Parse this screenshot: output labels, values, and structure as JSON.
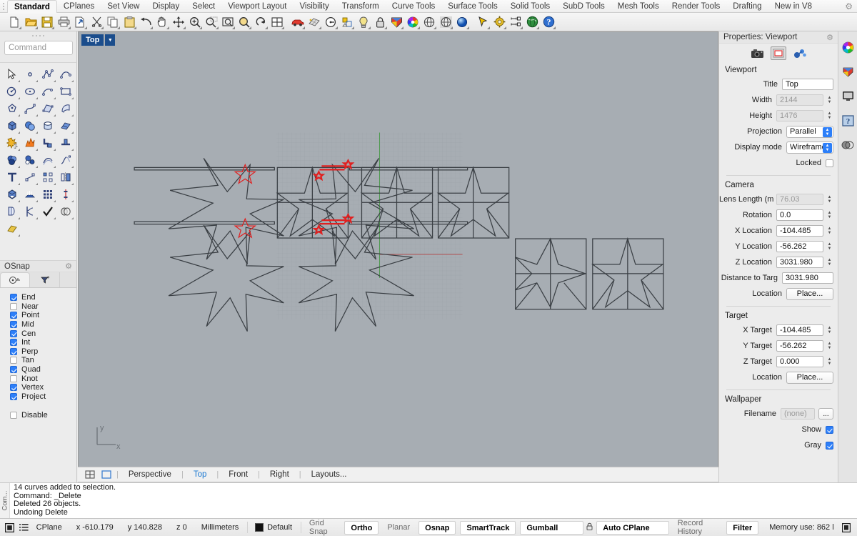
{
  "menu": {
    "items": [
      {
        "label": "Standard",
        "active": true
      },
      {
        "label": "CPlanes",
        "active": false
      },
      {
        "label": "Set View",
        "active": false
      },
      {
        "label": "Display",
        "active": false
      },
      {
        "label": "Select",
        "active": false
      },
      {
        "label": "Viewport Layout",
        "active": false
      },
      {
        "label": "Visibility",
        "active": false
      },
      {
        "label": "Transform",
        "active": false
      },
      {
        "label": "Curve Tools",
        "active": false
      },
      {
        "label": "Surface Tools",
        "active": false
      },
      {
        "label": "Solid Tools",
        "active": false
      },
      {
        "label": "SubD Tools",
        "active": false
      },
      {
        "label": "Mesh Tools",
        "active": false
      },
      {
        "label": "Render Tools",
        "active": false
      },
      {
        "label": "Drafting",
        "active": false
      },
      {
        "label": "New in V8",
        "active": false
      }
    ],
    "settings_icon": "gear-icon"
  },
  "toolbar": {
    "buttons": [
      {
        "name": "new-file-icon"
      },
      {
        "name": "open-file-icon"
      },
      {
        "name": "save-file-icon"
      },
      {
        "name": "print-icon"
      },
      {
        "name": "export-icon"
      },
      {
        "name": "cut-icon"
      },
      {
        "name": "copy-icon"
      },
      {
        "name": "paste-icon"
      },
      {
        "name": "undo-icon"
      },
      {
        "name": "pan-icon"
      },
      {
        "name": "move-icon"
      },
      {
        "name": "zoom-in-icon"
      },
      {
        "name": "zoom-window-icon"
      },
      {
        "name": "zoom-extents-icon"
      },
      {
        "name": "zoom-selected-icon"
      },
      {
        "name": "rotate-view-icon"
      },
      {
        "name": "four-view-icon"
      },
      {
        "name": "car-render-icon"
      },
      {
        "name": "render-mesh-icon"
      },
      {
        "name": "clock-icon"
      },
      {
        "name": "layer-icon"
      },
      {
        "name": "light-bulb-icon"
      },
      {
        "name": "lock-icon"
      },
      {
        "name": "material-icon"
      },
      {
        "name": "color-wheel-icon"
      },
      {
        "name": "environment-icon"
      },
      {
        "name": "ground-plane-icon"
      },
      {
        "name": "sphere-icon"
      },
      {
        "name": "cursor-arrow-icon"
      },
      {
        "name": "settings-gear-icon"
      },
      {
        "name": "dimension-icon"
      },
      {
        "name": "globe-icon"
      },
      {
        "name": "help-icon"
      }
    ]
  },
  "command": {
    "placeholder": "Command"
  },
  "tool_palette": {
    "buttons": [
      {
        "name": "select-arrow-icon"
      },
      {
        "name": "point-icon"
      },
      {
        "name": "polyline-icon"
      },
      {
        "name": "curve-icon"
      },
      {
        "name": "circle-icon"
      },
      {
        "name": "ellipse-icon"
      },
      {
        "name": "arc-icon"
      },
      {
        "name": "rectangle-icon"
      },
      {
        "name": "polygon-icon"
      },
      {
        "name": "curve-tools-icon"
      },
      {
        "name": "surface-icon"
      },
      {
        "name": "sweep-icon"
      },
      {
        "name": "box-icon"
      },
      {
        "name": "sphere-solid-icon"
      },
      {
        "name": "cylinder-icon"
      },
      {
        "name": "extrude-icon"
      },
      {
        "name": "transform-icon"
      },
      {
        "name": "explode-icon"
      },
      {
        "name": "fillet-icon"
      },
      {
        "name": "chamfer-icon"
      },
      {
        "name": "boolean-union-icon"
      },
      {
        "name": "boolean-difference-icon"
      },
      {
        "name": "offset-curve-icon"
      },
      {
        "name": "blend-curve-icon"
      },
      {
        "name": "text-icon"
      },
      {
        "name": "control-points-icon"
      },
      {
        "name": "array-icon"
      },
      {
        "name": "mirror-icon"
      },
      {
        "name": "cap-icon"
      },
      {
        "name": "loft-icon"
      },
      {
        "name": "grid-array-icon"
      },
      {
        "name": "analysis-icon"
      },
      {
        "name": "unroll-icon"
      },
      {
        "name": "split-icon"
      },
      {
        "name": "check-icon"
      },
      {
        "name": "intersect-icon"
      },
      {
        "name": "surface-patch-icon"
      }
    ]
  },
  "osnap": {
    "title": "OSnap",
    "settings_icon": "gear-icon",
    "tabs": [
      {
        "name": "osnap-tab-icon",
        "selected": true
      },
      {
        "name": "filter-tab-icon",
        "selected": false
      }
    ],
    "options": [
      {
        "label": "End",
        "checked": true
      },
      {
        "label": "Near",
        "checked": false
      },
      {
        "label": "Point",
        "checked": true
      },
      {
        "label": "Mid",
        "checked": true
      },
      {
        "label": "Cen",
        "checked": true
      },
      {
        "label": "Int",
        "checked": true
      },
      {
        "label": "Perp",
        "checked": true
      },
      {
        "label": "Tan",
        "checked": false
      },
      {
        "label": "Quad",
        "checked": true
      },
      {
        "label": "Knot",
        "checked": false
      },
      {
        "label": "Vertex",
        "checked": true
      },
      {
        "label": "Project",
        "checked": true
      }
    ],
    "disable": {
      "label": "Disable",
      "checked": false
    }
  },
  "viewport": {
    "title": "Top",
    "axis_x_label": "x",
    "axis_y_label": "y",
    "background_color": "#a7adb3",
    "geometry_color": "#3a3f44",
    "highlight_color": "#e02020",
    "grid_color": "#9ba2a8",
    "cplane_x_axis_color": "#b05050",
    "cplane_y_axis_color": "#4e9a4e"
  },
  "viewport_tabs": {
    "icons": [
      {
        "name": "four-viewport-layout-icon"
      },
      {
        "name": "single-viewport-layout-icon"
      }
    ],
    "items": [
      {
        "label": "Perspective",
        "selected": false
      },
      {
        "label": "Top",
        "selected": true
      },
      {
        "label": "Front",
        "selected": false
      },
      {
        "label": "Right",
        "selected": false
      },
      {
        "label": "Layouts...",
        "selected": false
      }
    ]
  },
  "properties": {
    "title": "Properties: Viewport",
    "settings_icon": "gear-icon",
    "tab_icons": [
      {
        "name": "camera-icon",
        "selected": false
      },
      {
        "name": "viewport-icon",
        "selected": true
      },
      {
        "name": "object-properties-icon",
        "selected": false
      }
    ],
    "sections": {
      "viewport": {
        "heading": "Viewport",
        "fields": [
          {
            "label": "Title",
            "value": "Top",
            "type": "text",
            "readonly": false
          },
          {
            "label": "Width",
            "value": "2144",
            "type": "spinner",
            "readonly": true
          },
          {
            "label": "Height",
            "value": "1476",
            "type": "spinner",
            "readonly": true
          },
          {
            "label": "Projection",
            "value": "Parallel",
            "type": "select"
          },
          {
            "label": "Display mode",
            "value": "Wireframe",
            "type": "select"
          },
          {
            "label": "Locked",
            "value": "",
            "type": "checkbox",
            "checked": false
          }
        ]
      },
      "camera": {
        "heading": "Camera",
        "fields": [
          {
            "label": "Lens Length (m",
            "value": "76.03",
            "type": "spinner",
            "readonly": true
          },
          {
            "label": "Rotation",
            "value": "0.0",
            "type": "spinner",
            "readonly": false
          },
          {
            "label": "X Location",
            "value": "-104.485",
            "type": "spinner",
            "readonly": false
          },
          {
            "label": "Y Location",
            "value": "-56.262",
            "type": "spinner",
            "readonly": false
          },
          {
            "label": "Z Location",
            "value": "3031.980",
            "type": "spinner",
            "readonly": false
          },
          {
            "label": "Distance to Targ",
            "value": "3031.980",
            "type": "text",
            "readonly": false
          },
          {
            "label": "Location",
            "value": "Place...",
            "type": "button"
          }
        ]
      },
      "target": {
        "heading": "Target",
        "fields": [
          {
            "label": "X Target",
            "value": "-104.485",
            "type": "spinner",
            "readonly": false
          },
          {
            "label": "Y Target",
            "value": "-56.262",
            "type": "spinner",
            "readonly": false
          },
          {
            "label": "Z Target",
            "value": "0.000",
            "type": "spinner",
            "readonly": false
          },
          {
            "label": "Location",
            "value": "Place...",
            "type": "button"
          }
        ]
      },
      "wallpaper": {
        "heading": "Wallpaper",
        "fields": [
          {
            "label": "Filename",
            "value": "(none)",
            "type": "file",
            "readonly": true,
            "browse": "..."
          },
          {
            "label": "Show",
            "value": "",
            "type": "checkbox",
            "checked": true
          },
          {
            "label": "Gray",
            "value": "",
            "type": "checkbox",
            "checked": true
          }
        ]
      }
    }
  },
  "rail": {
    "icons": [
      {
        "name": "color-wheel-panel-icon"
      },
      {
        "name": "materials-panel-icon"
      },
      {
        "name": "display-panel-icon"
      },
      {
        "name": "help-panel-icon"
      },
      {
        "name": "layers-panel-icon"
      }
    ]
  },
  "command_history": {
    "side_label": "Com...",
    "lines": [
      "14 curves added to selection.",
      "Command: _Delete",
      "Deleted 26 objects.",
      "Undoing Delete"
    ]
  },
  "status_bar": {
    "left_icons": [
      {
        "name": "layer-swatch-icon"
      },
      {
        "name": "list-icon"
      }
    ],
    "cplane_label": "CPlane",
    "coord_x": "x -610.179",
    "coord_y": "y 140.828",
    "coord_z": "z 0",
    "units": "Millimeters",
    "layer_color": "#111111",
    "layer_name": "Default",
    "toggles": [
      {
        "label": "Grid Snap",
        "on": false
      },
      {
        "label": "Ortho",
        "on": true
      },
      {
        "label": "Planar",
        "on": false
      },
      {
        "label": "Osnap",
        "on": true
      },
      {
        "label": "SmartTrack",
        "on": true
      },
      {
        "label": "Gumball (CPlane)",
        "on": true
      },
      {
        "label": "Auto CPlane (Object)",
        "on": true,
        "icon": "lock-icon"
      },
      {
        "label": "Record History",
        "on": false
      },
      {
        "label": "Filter",
        "on": true
      }
    ],
    "memory": "Memory use: 862 l",
    "right_icon": "monitor-icon"
  }
}
